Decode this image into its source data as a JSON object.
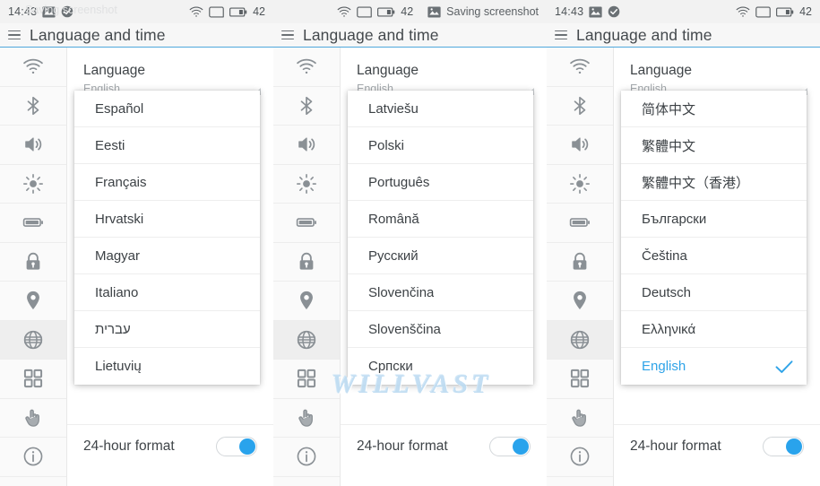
{
  "panels": [
    {
      "statusbar": {
        "time": "14:43",
        "ghost_text": "Saving screenshot",
        "battery_percent": "42",
        "show_time": true,
        "show_saving_label": false,
        "saving_label": ""
      },
      "appbar": {
        "title": "Language and time"
      },
      "setting": {
        "title": "Language",
        "value": "English"
      },
      "dropdown": {
        "items": [
          {
            "label": "Español",
            "selected": false
          },
          {
            "label": "Eesti",
            "selected": false
          },
          {
            "label": "Français",
            "selected": false
          },
          {
            "label": "Hrvatski",
            "selected": false
          },
          {
            "label": "Magyar",
            "selected": false
          },
          {
            "label": "Italiano",
            "selected": false
          },
          {
            "label": "עברית",
            "selected": false
          },
          {
            "label": "Lietuvių",
            "selected": false
          }
        ]
      },
      "hour_row": {
        "label": "24-hour format",
        "enabled": true
      }
    },
    {
      "statusbar": {
        "time": "",
        "ghost_text": "",
        "battery_percent": "42",
        "show_time": false,
        "show_saving_label": true,
        "saving_label": "Saving screenshot"
      },
      "appbar": {
        "title": "Language and time"
      },
      "setting": {
        "title": "Language",
        "value": "English"
      },
      "dropdown": {
        "items": [
          {
            "label": "Latviešu",
            "selected": false
          },
          {
            "label": "Polski",
            "selected": false
          },
          {
            "label": "Português",
            "selected": false
          },
          {
            "label": "Română",
            "selected": false
          },
          {
            "label": "Русский",
            "selected": false
          },
          {
            "label": "Slovenčina",
            "selected": false
          },
          {
            "label": "Slovenščina",
            "selected": false
          },
          {
            "label": "Српски",
            "selected": false
          }
        ]
      },
      "hour_row": {
        "label": "24-hour format",
        "enabled": true
      }
    },
    {
      "statusbar": {
        "time": "14:43",
        "ghost_text": "",
        "battery_percent": "42",
        "show_time": true,
        "show_saving_label": false,
        "saving_label": ""
      },
      "appbar": {
        "title": "Language and time"
      },
      "setting": {
        "title": "Language",
        "value": "English"
      },
      "dropdown": {
        "items": [
          {
            "label": "简体中文",
            "selected": false
          },
          {
            "label": "繁體中文",
            "selected": false
          },
          {
            "label": "繁體中文（香港）",
            "selected": false
          },
          {
            "label": "Български",
            "selected": false
          },
          {
            "label": "Čeština",
            "selected": false
          },
          {
            "label": "Deutsch",
            "selected": false
          },
          {
            "label": "Ελληνικά",
            "selected": false
          },
          {
            "label": "English",
            "selected": true
          }
        ]
      },
      "hour_row": {
        "label": "24-hour format",
        "enabled": true
      }
    }
  ],
  "sidebar": {
    "items": [
      {
        "icon": "wifi-icon",
        "active": false
      },
      {
        "icon": "bluetooth-icon",
        "active": false
      },
      {
        "icon": "volume-icon",
        "active": false
      },
      {
        "icon": "brightness-icon",
        "active": false
      },
      {
        "icon": "battery-icon",
        "active": false
      },
      {
        "icon": "lock-icon",
        "active": false
      },
      {
        "icon": "location-pin-icon",
        "active": false
      },
      {
        "icon": "globe-icon",
        "active": true
      },
      {
        "icon": "apps-grid-icon",
        "active": false
      },
      {
        "icon": "hand-pointer-icon",
        "active": false
      },
      {
        "icon": "info-icon",
        "active": false
      }
    ]
  },
  "watermark": {
    "text": "WILLVAST"
  },
  "colors": {
    "accent_blue": "#29a3ec",
    "header_underline": "#4fa8dc",
    "status_bg": "#f2f2f2",
    "sidebar_bg": "#fafafa",
    "sidebar_active_bg": "#eeeeee",
    "text_primary": "#3f4448",
    "text_secondary": "#a4a9ad",
    "watermark": "#bedcf2"
  }
}
